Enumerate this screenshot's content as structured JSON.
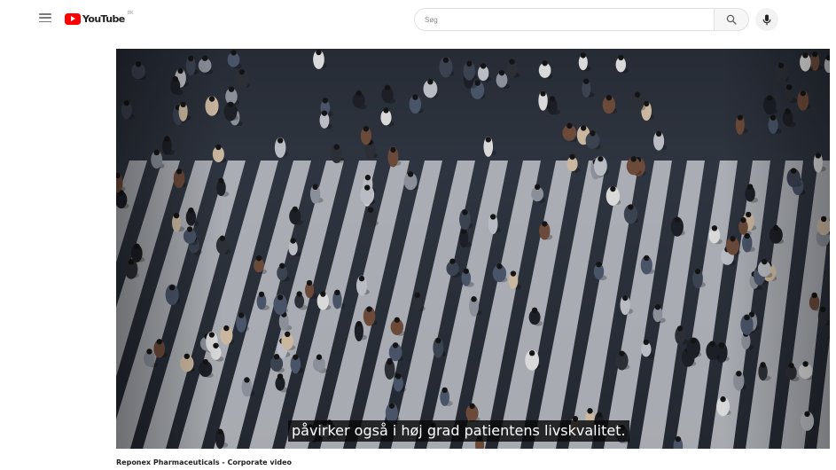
{
  "header": {
    "logo_text": "YouTube",
    "logo_country": "DK",
    "search_placeholder": "Søg",
    "icons": {
      "menu": "hamburger-menu-icon",
      "logo": "youtube-play-icon",
      "search": "search-icon",
      "mic": "microphone-icon"
    },
    "colors": {
      "logo_red": "#ff0000"
    }
  },
  "player": {
    "subtitle": "påvirker også i høj grad patientens livskvalitet."
  },
  "video": {
    "title": "Reponex Pharmaceuticals - Corporate video"
  }
}
